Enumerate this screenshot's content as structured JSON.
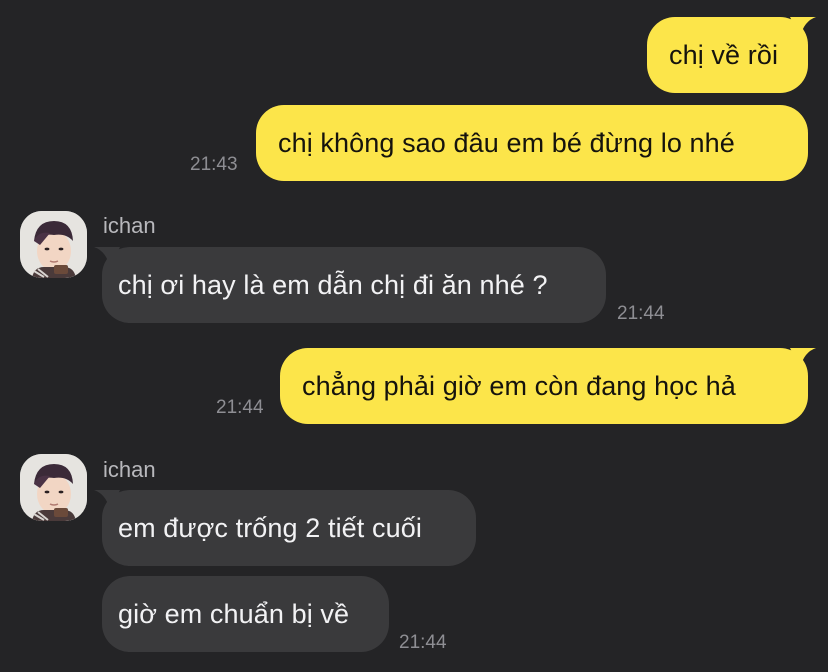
{
  "colors": {
    "background": "#242426",
    "outgoing_bubble": "#FCE54A",
    "incoming_bubble": "#3A3A3C",
    "timestamp": "#8E8E93"
  },
  "messages": [
    {
      "direction": "outgoing",
      "text": "chị về rồi"
    },
    {
      "direction": "outgoing",
      "text": "chị không sao đâu em bé đừng lo nhé",
      "time": "21:43"
    },
    {
      "direction": "incoming",
      "sender": "ichan",
      "avatar_icon": "user-avatar-photo",
      "text": "chị ơi hay là em dẫn chị đi ăn nhé ?",
      "time": "21:44"
    },
    {
      "direction": "outgoing",
      "text": "chẳng phải giờ em còn đang học hả",
      "time": "21:44"
    },
    {
      "direction": "incoming",
      "sender": "ichan",
      "avatar_icon": "user-avatar-photo",
      "text": "em được trống 2 tiết cuối"
    },
    {
      "direction": "incoming",
      "text": "giờ em chuẩn bị về",
      "time": "21:44"
    }
  ]
}
